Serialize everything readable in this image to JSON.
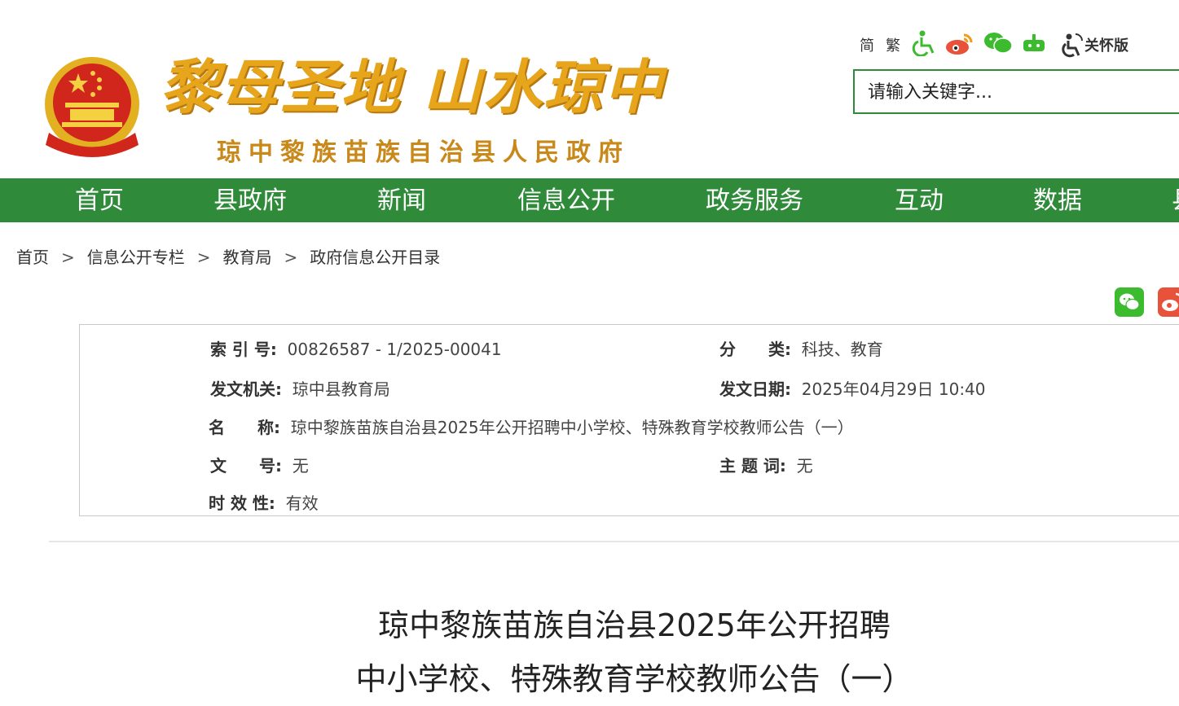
{
  "header": {
    "slogan": "黎母圣地 山水琼中",
    "site_name": "琼中黎族苗族自治县人民政府",
    "lang_simplified": "简",
    "lang_traditional": "繁",
    "care_mode": "关怀版",
    "search_placeholder": "请输入关键字..."
  },
  "nav": {
    "items": [
      "首页",
      "县政府",
      "新闻",
      "信息公开",
      "政务服务",
      "互动",
      "数据",
      "县"
    ]
  },
  "breadcrumb": {
    "items": [
      "首页",
      "信息公开专栏",
      "教育局",
      "政府信息公开目录"
    ],
    "separator": ">"
  },
  "info": {
    "index_label": "索 引 号:",
    "index_value": "00826587 - 1/2025-00041",
    "category_label": "分　　类:",
    "category_value": "科技、教育",
    "issuer_label": "发文机关:",
    "issuer_value": "琼中县教育局",
    "date_label": "发文日期:",
    "date_value": "2025年04月29日 10:40",
    "name_label": "名　　称:",
    "name_value": "琼中黎族苗族自治县2025年公开招聘中小学校、特殊教育学校教师公告（一）",
    "docno_label": "文　　号:",
    "docno_value": "无",
    "keyword_label": "主 题 词:",
    "keyword_value": "无",
    "validity_label": "时 效 性:",
    "validity_value": "有效"
  },
  "article": {
    "title_line1": "琼中黎族苗族自治县2025年公开招聘",
    "title_line2": "中小学校、特殊教育学校教师公告（一）"
  },
  "colors": {
    "nav_green": "#2f8a3a",
    "slogan_gold": "#e7a51c",
    "emblem_red": "#d0261c"
  }
}
